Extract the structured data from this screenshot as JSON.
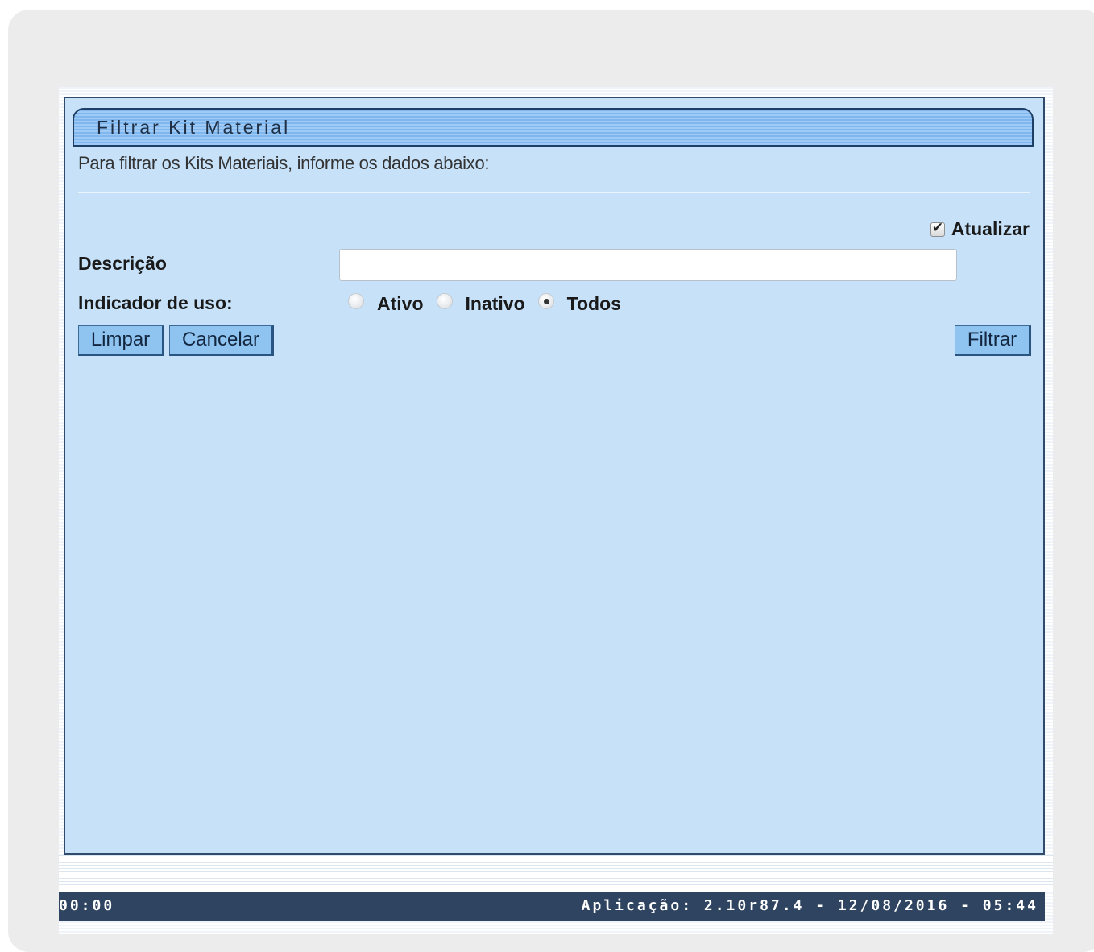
{
  "panel": {
    "title": "Filtrar Kit Material",
    "intro": "Para filtrar os Kits Materiais, informe os dados abaixo:"
  },
  "form": {
    "atualizar": {
      "label": "Atualizar",
      "checked": true
    },
    "descricao": {
      "label": "Descrição",
      "value": "",
      "placeholder": ""
    },
    "indicador_uso": {
      "label": "Indicador de uso:",
      "options": [
        {
          "label": "Ativo",
          "selected": false
        },
        {
          "label": "Inativo",
          "selected": false
        },
        {
          "label": "Todos",
          "selected": true
        }
      ]
    }
  },
  "buttons": {
    "limpar": "Limpar",
    "cancelar": "Cancelar",
    "filtrar": "Filtrar"
  },
  "status_bar": {
    "left": "00:00",
    "right": "Aplicação: 2.10r87.4 - 12/08/2016 - 05:44"
  },
  "colors": {
    "panel_bg": "#c6e1f8",
    "title_bar": "#7fb7ee",
    "button_bg": "#8fc3f0",
    "status_bar_bg": "#2f4460"
  }
}
